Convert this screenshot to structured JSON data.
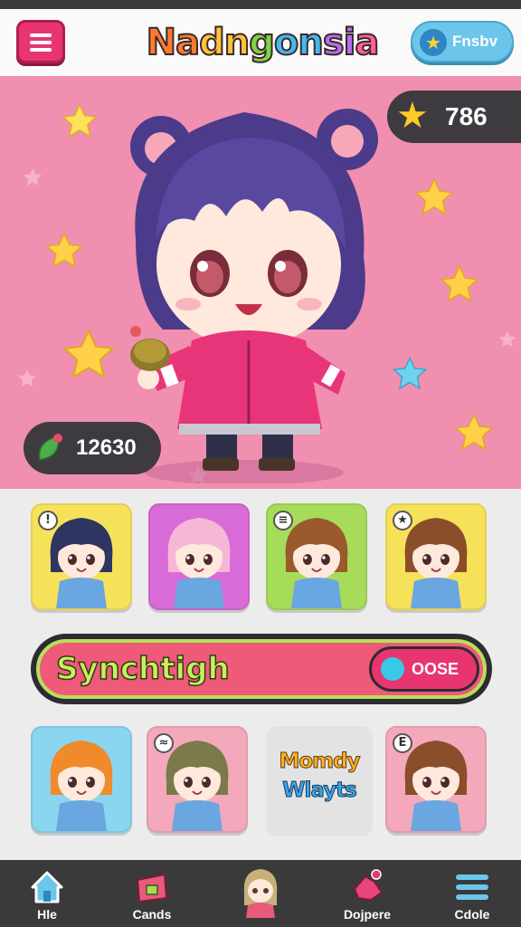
{
  "header": {
    "title_parts": [
      "Na",
      "dn",
      "g",
      "on",
      "si",
      "a"
    ],
    "pill_button_label": "Fnsbv"
  },
  "scene": {
    "score_value": "786",
    "currency_value": "12630"
  },
  "character_cards_row1": [
    {
      "bg": "#f6e25a",
      "hair": "#2e3560",
      "tag": "!"
    },
    {
      "bg": "#d86bd8",
      "hair": "#f6b7d6",
      "tag": ""
    },
    {
      "bg": "#a6dc5a",
      "hair": "#9a5a2c",
      "tag": "≡"
    },
    {
      "bg": "#f6e25a",
      "hair": "#8a4e2a",
      "tag": "★"
    }
  ],
  "sync_bar": {
    "label": "Synchtigh",
    "button_label": "OOSE"
  },
  "character_cards_row2": [
    {
      "bg": "#8ad6f0",
      "hair": "#f08a2a",
      "tag": ""
    },
    {
      "bg": "#f3a9bb",
      "hair": "#7a7a4a",
      "tag": "≈"
    },
    {
      "bg": "#f3a9bb",
      "hair": "#8a4e2a",
      "tag": "E"
    }
  ],
  "promo": {
    "line1": "Momdy",
    "line2": "Wlayts"
  },
  "navbar": {
    "items": [
      {
        "label": "Hle",
        "icon": "home-icon"
      },
      {
        "label": "Cands",
        "icon": "card-box-icon"
      },
      {
        "label": "",
        "icon": "avatar-icon"
      },
      {
        "label": "Dojpere",
        "icon": "explore-icon"
      },
      {
        "label": "Cdole",
        "icon": "menu-lines-icon"
      }
    ]
  },
  "colors": {
    "accent_pink": "#e8356f",
    "scene_pink": "#f08fb0",
    "sync_green": "#b5e05a",
    "dark": "#3a3a3a"
  }
}
